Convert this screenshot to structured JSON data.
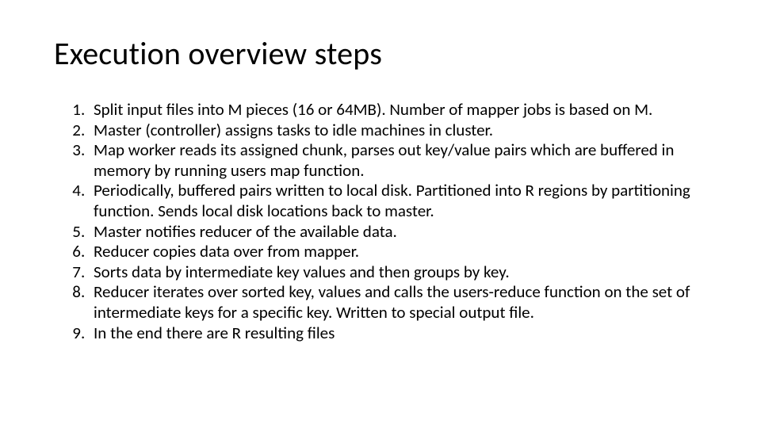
{
  "title": "Execution overview steps",
  "steps": [
    "Split input files into M pieces (16 or 64MB).  Number of mapper jobs is based on M.",
    "Master (controller) assigns tasks to idle machines in cluster.",
    "Map worker reads its assigned chunk, parses out key/value pairs which are buffered in memory by running users map function.",
    "Periodically, buffered pairs written to local disk. Partitioned into R regions by partitioning function.  Sends local disk locations back to master.",
    "Master notifies reducer of the available data.",
    "Reducer copies data over from mapper.",
    "Sorts data by intermediate key values and then groups by key.",
    "Reducer iterates over sorted key, values and calls the users-reduce function on the set of intermediate keys for a specific key.  Written to special output file.",
    "In the end there are R resulting files"
  ]
}
